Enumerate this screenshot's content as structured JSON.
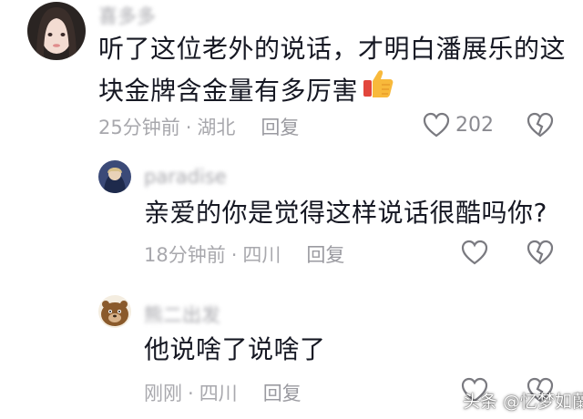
{
  "comments": [
    {
      "username": "喜多多",
      "text_line1": "听了这位老外的说话，才明白潘展乐的这",
      "text_line2": "块金牌含金量有多厉害",
      "emoji": "thumbs-up-emoji",
      "time": "25分钟前",
      "location": "湖北",
      "reply": "回复",
      "likes": "202"
    },
    {
      "username": "paradise",
      "text": "亲爱的你是觉得这样说话很酷吗你?",
      "time": "18分钟前",
      "location": "四川",
      "reply": "回复"
    },
    {
      "username": "熊二出发",
      "text": "他说啥了说啥了",
      "time": "刚刚",
      "location": "四川",
      "reply": "回复"
    }
  ],
  "watermark": "头条 @忆梦如蘭",
  "separator": "·"
}
